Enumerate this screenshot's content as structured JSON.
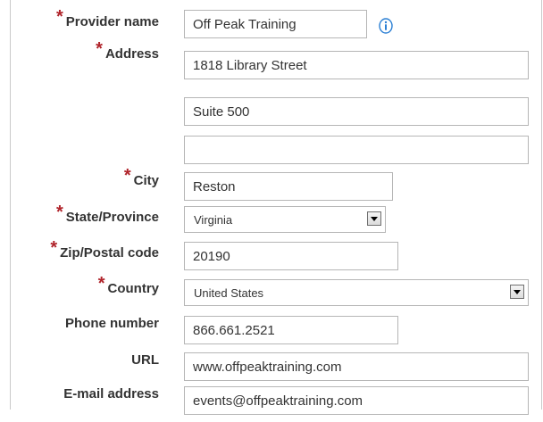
{
  "form": {
    "provider_name": {
      "label": "Provider name",
      "value": "Off Peak Training",
      "required": true
    },
    "address": {
      "label": "Address",
      "line1": "1818 Library Street",
      "line2": "Suite 500",
      "line3": "",
      "required": true
    },
    "city": {
      "label": "City",
      "value": "Reston",
      "required": true
    },
    "state": {
      "label": "State/Province",
      "selected": "Virginia",
      "required": true
    },
    "zip": {
      "label": "Zip/Postal code",
      "value": "20190",
      "required": true
    },
    "country": {
      "label": "Country",
      "selected": "United States",
      "required": true
    },
    "phone": {
      "label": "Phone number",
      "value": "866.661.2521"
    },
    "url": {
      "label": "URL",
      "value": "www.offpeaktraining.com"
    },
    "email": {
      "label": "E-mail address",
      "value": "events@offpeaktraining.com"
    },
    "required_marker": "*"
  },
  "icons": {
    "info": "info-icon"
  },
  "colors": {
    "required": "#b0232a",
    "info": "#2a7fd4",
    "label": "#333333",
    "border": "#b6b6b6"
  }
}
